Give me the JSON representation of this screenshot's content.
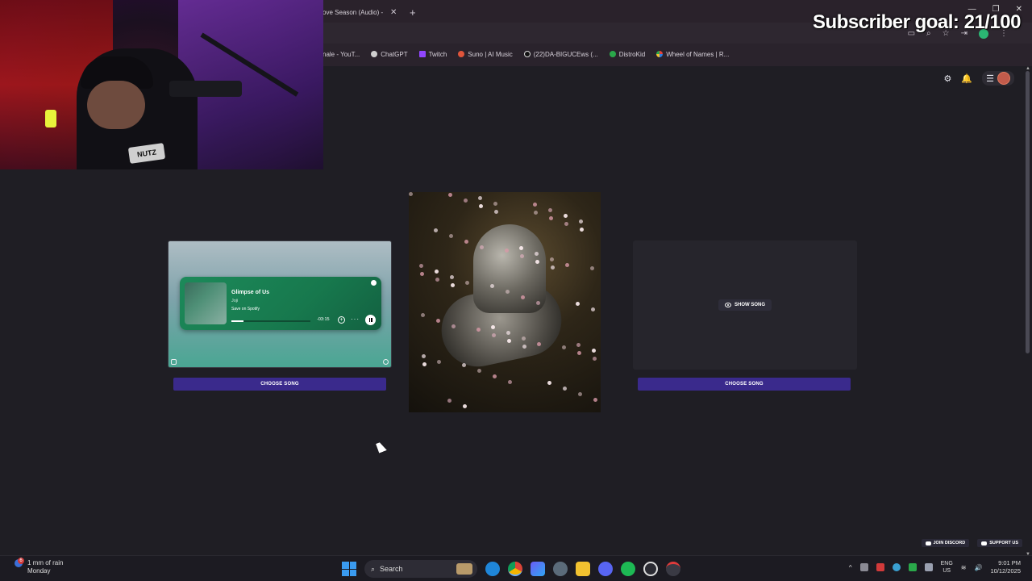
{
  "browser": {
    "tab_title": "ove Season (Audio) -",
    "tab_close": "✕",
    "new_tab": "+",
    "window_controls": [
      "—",
      "❐",
      "✕"
    ],
    "bookmarks": [
      {
        "label": "nale - YouT...",
        "color": "#d11"
      },
      {
        "label": "ChatGPT",
        "color": "#cfcfcf"
      },
      {
        "label": "Twitch",
        "color": "#9146ff"
      },
      {
        "label": "Suno | AI Music",
        "color": "#e0553b"
      },
      {
        "label": "(22)DA-BIGUCEws (...",
        "color": "#000"
      },
      {
        "label": "DistroKid",
        "color": "#2aa84a"
      },
      {
        "label": "Wheel of Names | R...",
        "color": "#e2433b"
      }
    ]
  },
  "overlay": {
    "subscriber_goal": "Subscriber goal: 21/100",
    "webcam_shirt_logo": "NUTZ"
  },
  "header": {
    "icons": [
      "gear-icon",
      "bell-icon",
      "menu-icon",
      "avatar"
    ]
  },
  "left_card": {
    "spotify": {
      "song_title": "Glimpse of Us",
      "artist": "Joji",
      "save_label": "Save on Spotify",
      "time_remaining": "-03:15",
      "progress": 0.15
    },
    "choose_button": "CHOOSE SONG"
  },
  "right_card": {
    "show_song_button": "SHOW SONG",
    "choose_button": "CHOOSE SONG"
  },
  "footer": {
    "join_discord": "JOIN DISCORD",
    "support_us": "SUPPORT US"
  },
  "taskbar": {
    "weather_line1": "1 mm of rain",
    "weather_line2": "Monday",
    "weather_badge": "6",
    "search_placeholder": "Search",
    "lang_line1": "ENG",
    "lang_line2": "US",
    "time": "9:01 PM",
    "date": "10/12/2025"
  }
}
